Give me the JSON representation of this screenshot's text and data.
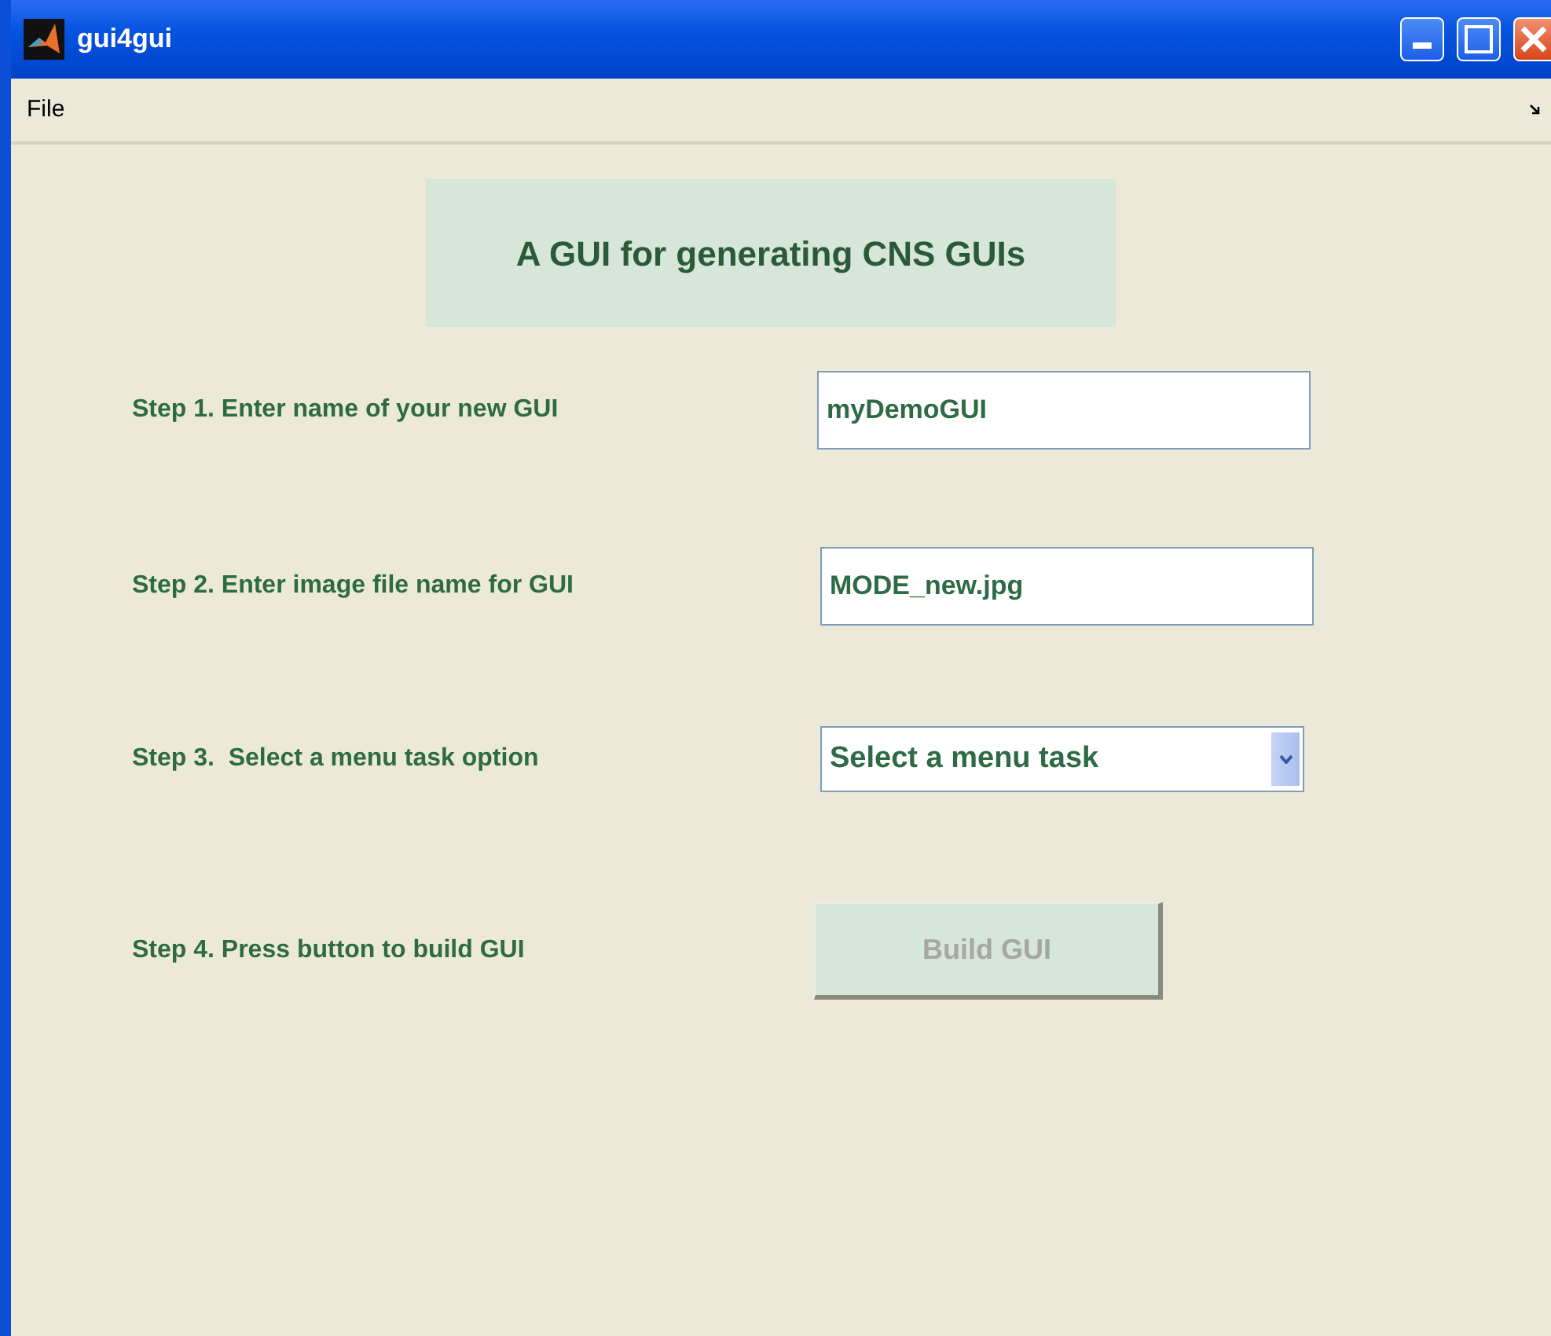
{
  "window": {
    "title": "gui4gui"
  },
  "menu": [
    "File"
  ],
  "heading": "A GUI for generating CNS GUIs",
  "steps": [
    {
      "kind": "text",
      "label": "Step 1. Enter name of your new GUI",
      "value": "myDemoGUI"
    },
    {
      "kind": "text",
      "label": "Step 2. Enter image file name for GUI",
      "value": "MODE_new.jpg"
    },
    {
      "kind": "select",
      "label": "Step 3.  Select a menu task option",
      "value": "Select a menu task"
    },
    {
      "kind": "button",
      "label": "Step 4. Press button to build GUI",
      "value": "Build GUI",
      "disabled": true
    }
  ]
}
